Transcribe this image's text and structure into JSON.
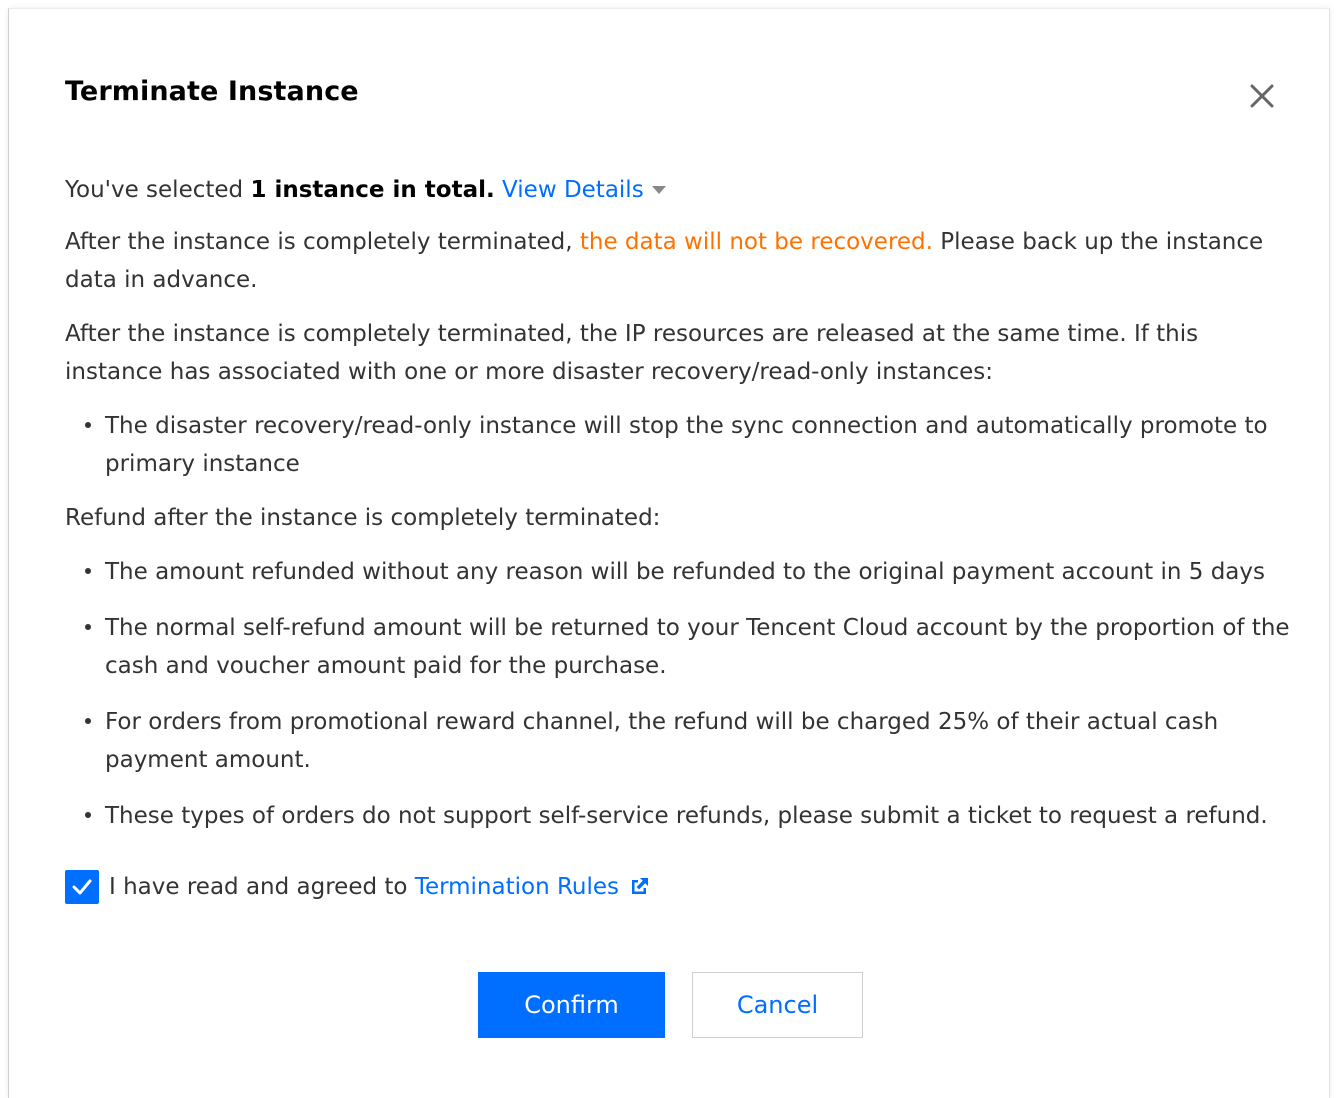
{
  "dialog": {
    "title": "Terminate Instance"
  },
  "selection": {
    "prefix": "You've selected ",
    "count_text": "1 instance in total.",
    "view_details": "View Details"
  },
  "warning": {
    "before": "After the instance is completely terminated, ",
    "highlight": "the data will not be recovered.",
    "after": " Please back up the instance data in advance."
  },
  "ip_release": {
    "text": "After the instance is completely terminated, the IP resources are released at the same time. If this instance has associated with one or more disaster recovery/read-only instances:"
  },
  "dr_bullets": [
    "The disaster recovery/read-only instance will stop the sync connection and automatically promote to primary instance"
  ],
  "refund": {
    "heading": "Refund after the instance is completely terminated:",
    "bullets": [
      "The amount refunded without any reason will be refunded to the original payment account in 5 days",
      "The normal self-refund amount will be returned to your Tencent Cloud account by the proportion of the cash and voucher amount paid for the purchase.",
      "For orders from promotional reward channel, the refund will be charged 25% of their actual cash payment amount.",
      "These types of orders do not support self-service refunds, please submit a ticket to request a refund."
    ]
  },
  "agreement": {
    "checked": true,
    "label": "I have read and agreed to ",
    "link": "Termination Rules"
  },
  "buttons": {
    "confirm": "Confirm",
    "cancel": "Cancel"
  },
  "colors": {
    "accent": "#006eff",
    "warning": "#ff7200",
    "text": "#333333"
  },
  "icons": {
    "close": "close-icon",
    "caret": "caret-down-icon",
    "check": "checkmark-icon",
    "external": "external-link-icon"
  }
}
